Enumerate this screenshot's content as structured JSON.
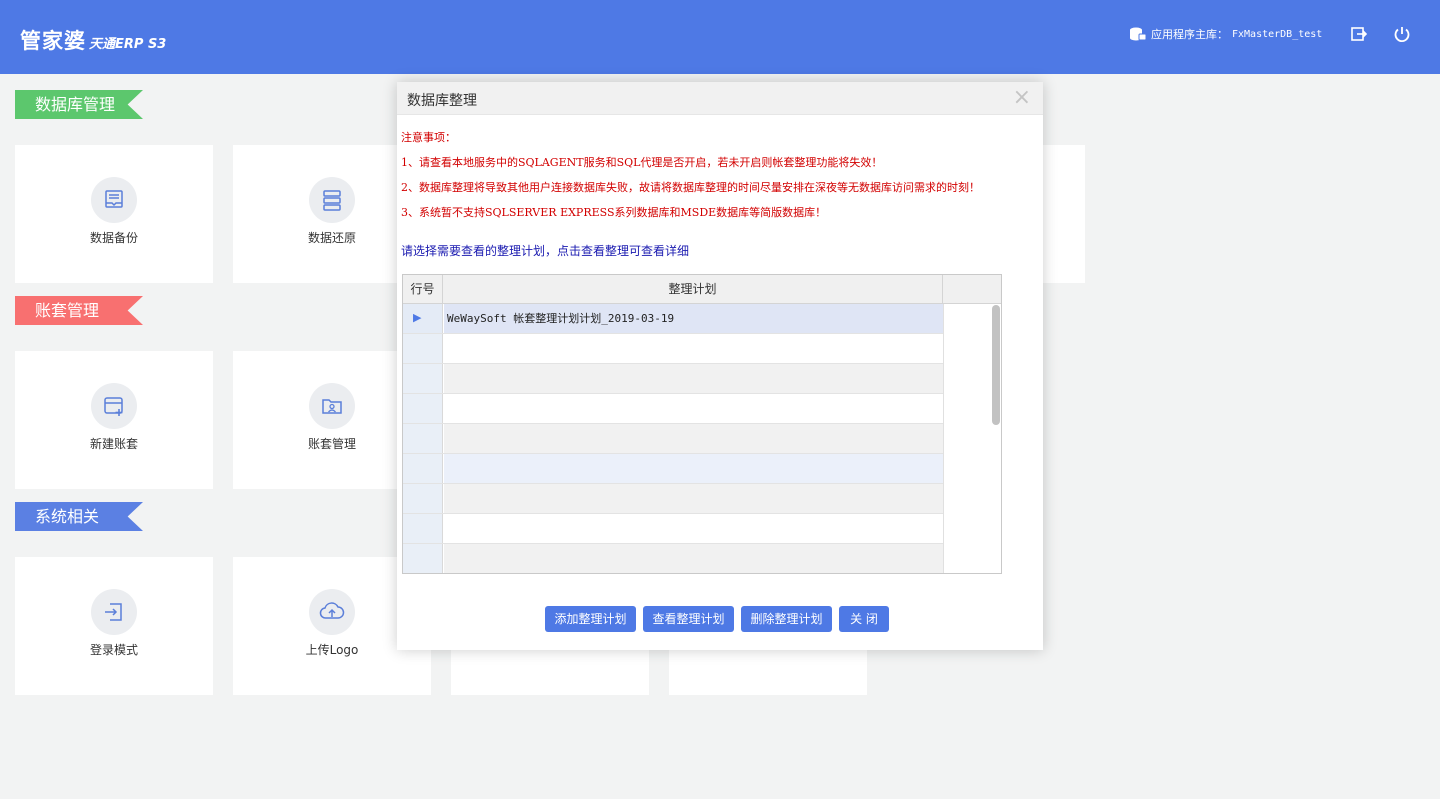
{
  "header": {
    "logo_main": "管家婆",
    "logo_sub": "天通ERP S3",
    "db_label": "应用程序主库：",
    "db_value": "FxMasterDB_test",
    "icons": [
      "database-icon",
      "exit-icon",
      "power-icon"
    ]
  },
  "sections": [
    {
      "title": "数据库管理",
      "color": "#5cc76d"
    },
    {
      "title": "账套管理",
      "color": "#f87070"
    },
    {
      "title": "系统相关",
      "color": "#5b80e3"
    }
  ],
  "tiles": {
    "backup": "数据备份",
    "restore": "数据还原",
    "new_account": "新建账套",
    "account_mgmt": "账套管理",
    "login_mode": "登录模式",
    "upload_logo": "上传Logo"
  },
  "dialog": {
    "title": "数据库整理",
    "close": "×",
    "notice_title": "注意事项：",
    "notice_1": "1、请查看本地服务中的SQLAGENT服务和SQL代理是否开启，若未开启则帐套整理功能将失效！",
    "notice_2": "2、数据库整理将导致其他用户连接数据库失败，故请将数据库整理的时间尽量安排在深夜等无数据库访问需求的时刻！",
    "notice_3": "3、系统暂不支持SQLSERVER EXPRESS系列数据库和MSDE数据库等简版数据库！",
    "prompt": "请选择需要查看的整理计划，点击查看整理可查看详细",
    "grid": {
      "col_rownum": "行号",
      "col_plan": "整理计划",
      "row_marker": "▶",
      "rows": [
        "WeWaySoft 帐套整理计划计划_2019-03-19",
        "",
        "",
        "",
        "",
        "",
        "",
        "",
        ""
      ]
    },
    "buttons": {
      "add": "添加整理计划",
      "view": "查看整理计划",
      "delete": "删除整理计划",
      "close": "关 闭"
    }
  }
}
